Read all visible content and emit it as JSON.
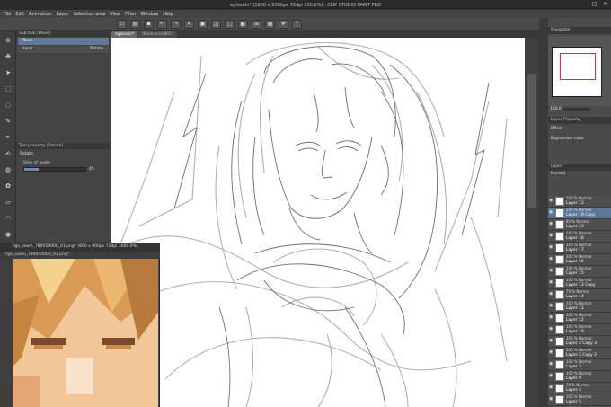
{
  "window": {
    "title": "eglovein* (1800 x 2000px 72dpi 150.0%) - CLIP STUDIO PAINT PRO",
    "controls": [
      "–",
      "□",
      "✕"
    ]
  },
  "menu": [
    "File",
    "Edit",
    "Animation",
    "Layer",
    "Selection area",
    "View",
    "Filter",
    "Window",
    "Help"
  ],
  "subtool": {
    "header": "Sub tool [Move]",
    "items": [
      "Move",
      "Hand",
      "Rotate"
    ]
  },
  "toolprop": {
    "header": "Tool property [Rotate]",
    "name": "Rotate",
    "step_label": "Step of angle",
    "step_value": "45"
  },
  "canvas_tabs": [
    "eglovein*",
    "Illustration001*"
  ],
  "ref_window": {
    "title": "Ilgo_zoom_789050000_01.png* (800 x 800px 72dpi 1600.0%)",
    "tab": "Ilgo_zoom_789050000_01.png*"
  },
  "navigator": {
    "header": "Navigator",
    "zoom": "150.0"
  },
  "layer_property": {
    "header": "Layer Property",
    "effect_label": "Effect",
    "expr_label": "Expression color"
  },
  "layer_panel": {
    "header": "Layer",
    "blend": "Normal"
  },
  "layers": [
    {
      "meta": "100 % Normal",
      "name": "Layer 12"
    },
    {
      "meta": "100 % Normal",
      "name": "Layer 19 Copy"
    },
    {
      "meta": "85 % Normal",
      "name": "Layer 19"
    },
    {
      "meta": "100 % Normal",
      "name": "Layer 18"
    },
    {
      "meta": "100 % Normal",
      "name": "Layer 17"
    },
    {
      "meta": "100 % Normal",
      "name": "Layer 16"
    },
    {
      "meta": "100 % Normal",
      "name": "Layer 15"
    },
    {
      "meta": "100 % Normal",
      "name": "Layer 13 Copy"
    },
    {
      "meta": "76 % Normal",
      "name": "Layer 14"
    },
    {
      "meta": "100 % Normal",
      "name": "Layer 11"
    },
    {
      "meta": "100 % Normal",
      "name": "Layer 12"
    },
    {
      "meta": "100 % Normal",
      "name": "Layer 10"
    },
    {
      "meta": "100 % Normal",
      "name": "Layer 2 Copy 3"
    },
    {
      "meta": "100 % Normal",
      "name": "Layer 2 Copy 2"
    },
    {
      "meta": "100 % Normal",
      "name": "Layer 3"
    },
    {
      "meta": "100 % Normal",
      "name": "Layer 9"
    },
    {
      "meta": "76 % Normal",
      "name": "Layer 4"
    },
    {
      "meta": "100 % Normal",
      "name": "Layer 5"
    },
    {
      "meta": "100 % Normal",
      "name": "Layer 8"
    }
  ]
}
